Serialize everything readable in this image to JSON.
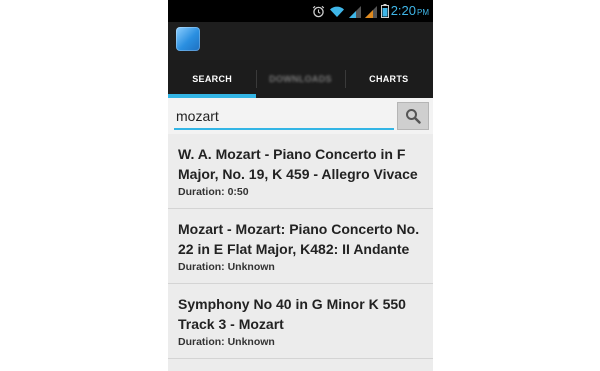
{
  "status_bar": {
    "time": "2:20",
    "ampm": "PM",
    "icons": [
      "alarm-icon",
      "wifi-icon",
      "signal-icon",
      "signal-icon",
      "battery-icon"
    ],
    "accent": "#3fb6e8"
  },
  "action_bar": {
    "app_icon": "app-icon"
  },
  "tabs": [
    {
      "label": "SEARCH",
      "active": true
    },
    {
      "label": "DOWNLOADS",
      "active": false
    },
    {
      "label": "CHARTS",
      "active": false
    }
  ],
  "search": {
    "value": "mozart",
    "button_icon": "search-icon"
  },
  "results": [
    {
      "title": "W. A. Mozart - Piano Concerto in F Major, No. 19, K 459 - Allegro Vivace",
      "duration": "Duration: 0:50"
    },
    {
      "title": "Mozart - Mozart: Piano Concerto No. 22 in E Flat Major, K482: II Andante",
      "duration": "Duration: Unknown"
    },
    {
      "title": "Symphony No 40 in G Minor K 550 Track 3 - Mozart",
      "duration": "Duration: Unknown"
    }
  ],
  "colors": {
    "accent": "#33b5e5",
    "tab_background": "#1c1c1c",
    "list_background": "#ececec"
  }
}
